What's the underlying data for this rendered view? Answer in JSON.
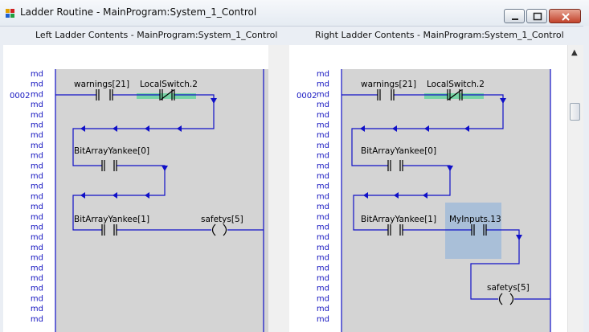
{
  "window": {
    "title": "Ladder Routine - MainProgram:System_1_Control"
  },
  "headers": {
    "left": "Left  Ladder  Contents  -  MainProgram:System_1_Control",
    "right": "Right  Ladder  Contents  -  MainProgram:System_1_Control"
  },
  "margin_marker": "md",
  "rung_number": "0002",
  "left_rung": {
    "contacts": [
      {
        "tag": "warnings[21]",
        "type": "XIC"
      },
      {
        "tag": "LocalSwitch.2",
        "type": "XIO",
        "highlight": "green"
      },
      {
        "tag": "BitArrayYankee[0]",
        "type": "XIC"
      },
      {
        "tag": "BitArrayYankee[1]",
        "type": "XIC"
      }
    ],
    "coil": {
      "tag": "safetys[5]",
      "type": "OTE"
    }
  },
  "right_rung": {
    "contacts": [
      {
        "tag": "warnings[21]",
        "type": "XIC"
      },
      {
        "tag": "LocalSwitch.2",
        "type": "XIO",
        "highlight": "green"
      },
      {
        "tag": "BitArrayYankee[0]",
        "type": "XIC"
      },
      {
        "tag": "BitArrayYankee[1]",
        "type": "XIC"
      },
      {
        "tag": "MyInputs.13",
        "type": "XIC",
        "selected": true
      }
    ],
    "coil": {
      "tag": "safetys[5]",
      "type": "OTE"
    }
  },
  "colors": {
    "wire": "#1010c8",
    "rung_background": "#d4d4d4",
    "margin_text": "#1515c0",
    "selection": "#a9bfd8",
    "highlight": "#5fd39a"
  }
}
